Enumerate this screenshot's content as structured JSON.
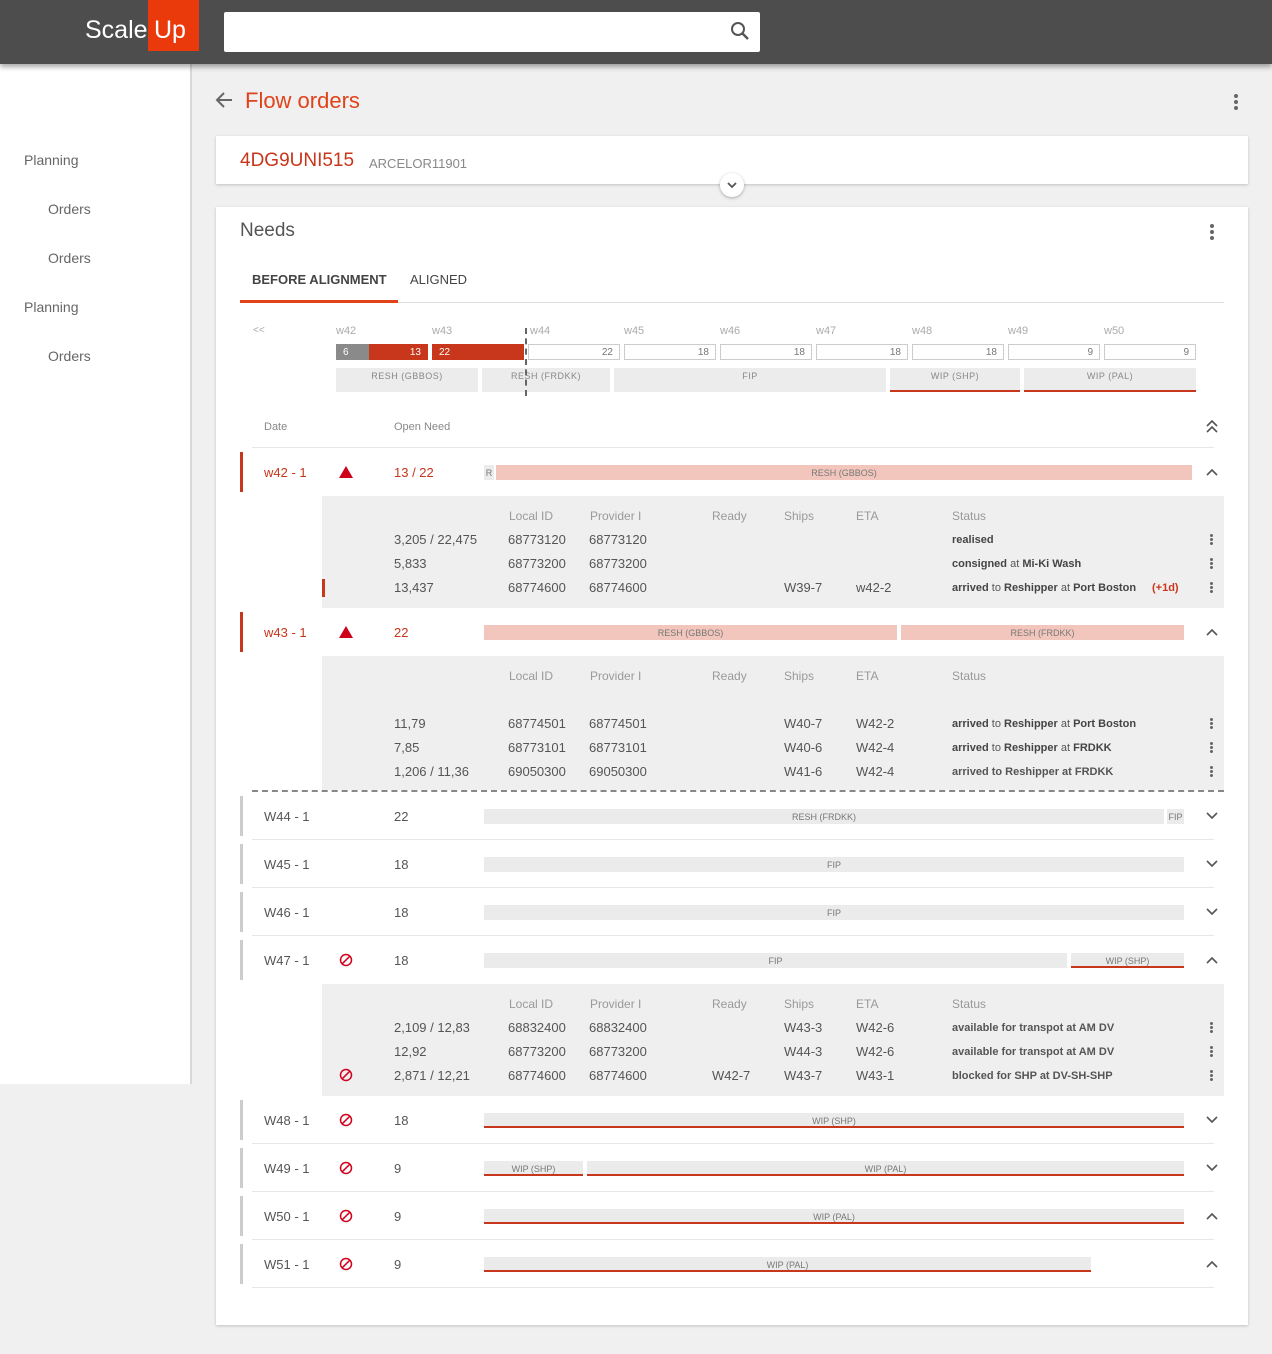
{
  "brand": {
    "scale": "Scale",
    "up": "Up",
    "accent": "#ea3a0c"
  },
  "search": {
    "placeholder": ""
  },
  "sidebar": [
    "Planning",
    "Orders",
    "Orders",
    "Planning",
    "Orders"
  ],
  "page": {
    "title": "Flow orders"
  },
  "order": {
    "id": "4DG9UNI515",
    "sub": "ARCELOR11901"
  },
  "needs": {
    "title": "Needs",
    "tabs": [
      "BEFORE ALIGNMENT",
      "ALIGNED"
    ]
  },
  "timeline": {
    "prev": "<<",
    "weeks": [
      "w42",
      "w43",
      "w44",
      "w45",
      "w46",
      "w47",
      "w48",
      "w49",
      "w50"
    ],
    "cells": [
      "6",
      "13",
      "22",
      "22",
      "18",
      "18",
      "18",
      "18",
      "9",
      "9"
    ],
    "lanes": [
      "RESH (GBBOS)",
      "RESH (FRDKK)",
      "FIP",
      "WIP (SHP)",
      "WIP (PAL)"
    ]
  },
  "table": {
    "headers": {
      "date": "Date",
      "need": "Open Need"
    }
  },
  "detail_headers": [
    "Local ID",
    "Provider I",
    "Ready",
    "Ships",
    "ETA",
    "Status"
  ],
  "rows": [
    {
      "date": "w42 - 1",
      "need": "13 / 22",
      "bars": [
        "R",
        "RESH  (GBBOS)"
      ],
      "details": [
        {
          "qty": "3,205 / 22,475",
          "local": "68773120",
          "prov": "68773120",
          "ready": "",
          "ships": "",
          "eta": "",
          "status": [
            "realised"
          ]
        },
        {
          "qty": "5,833",
          "local": "68773200",
          "prov": "68773200",
          "ready": "",
          "ships": "",
          "eta": "",
          "status": [
            "consigned",
            " at ",
            "Mi-Ki Wash"
          ]
        },
        {
          "qty": "13,437",
          "local": "68774600",
          "prov": "68774600",
          "ready": "",
          "ships": "W39-7",
          "eta": "w42-2",
          "status": [
            "arrived",
            " to ",
            "Reshipper",
            " at ",
            "Port Boston"
          ],
          "delay": "(+1d)"
        }
      ]
    },
    {
      "date": "w43 - 1",
      "need": "22",
      "bars": [
        "RESH  (GBBOS)",
        "RESH  (FRDKK)"
      ],
      "details": [
        {
          "qty": "11,79",
          "local": "68774501",
          "prov": "68774501",
          "ready": "",
          "ships": "W40-7",
          "eta": "W42-2",
          "status": [
            "arrived",
            " to ",
            "Reshipper",
            " at ",
            "Port Boston"
          ]
        },
        {
          "qty": "7,85",
          "local": "68773101",
          "prov": "68773101",
          "ready": "",
          "ships": "W40-6",
          "eta": "W42-4",
          "status": [
            "arrived",
            " to ",
            "Reshipper",
            " at ",
            "FRDKK"
          ]
        },
        {
          "qty": "1,206 / 11,36",
          "local": "69050300",
          "prov": "69050300",
          "ready": "",
          "ships": "W41-6",
          "eta": "W42-4",
          "status": [
            "arrived to Reshipper at FRDKK"
          ]
        }
      ]
    },
    {
      "date": "W44 - 1",
      "need": "22",
      "bars": [
        "RESH  (FRDKK)",
        "FIP"
      ]
    },
    {
      "date": "W45 - 1",
      "need": "18",
      "bars": [
        "FIP"
      ]
    },
    {
      "date": "W46 - 1",
      "need": "18",
      "bars": [
        "FIP"
      ]
    },
    {
      "date": "W47 - 1",
      "need": "18",
      "bars": [
        "FIP",
        "WIP  (SHP)"
      ],
      "details": [
        {
          "qty": "2,109 / 12,83",
          "local": "68832400",
          "prov": "68832400",
          "ready": "",
          "ships": "W43-3",
          "eta": "W42-6",
          "status": [
            "available for transpot at AM DV"
          ]
        },
        {
          "qty": "12,92",
          "local": "68773200",
          "prov": "68773200",
          "ready": "",
          "ships": "W44-3",
          "eta": "W42-6",
          "status": [
            "available for transpot at AM DV"
          ]
        },
        {
          "qty": "2,871 / 12,21",
          "local": "68774600",
          "prov": "68774600",
          "ready": "W42-7",
          "ships": "W43-7",
          "eta": "W43-1",
          "status": [
            "blocked for SHP at DV-SH-SHP"
          ]
        }
      ]
    },
    {
      "date": "W48 - 1",
      "need": "18",
      "bars": [
        "WIP  (SHP)"
      ]
    },
    {
      "date": "W49 - 1",
      "need": "9",
      "bars": [
        "WIP  (SHP)",
        "WIP (PAL)"
      ]
    },
    {
      "date": "W50 - 1",
      "need": "9",
      "bars": [
        "WIP (PAL)"
      ]
    },
    {
      "date": "W51 - 1",
      "need": "9",
      "bars": [
        "WIP (PAL)"
      ]
    }
  ],
  "colors": {
    "accent": "#e0421a",
    "danger": "#d0021b",
    "barFill": "#ebebeb",
    "pinkFill": "#f2c6bc",
    "darkRed": "#c8361b"
  }
}
